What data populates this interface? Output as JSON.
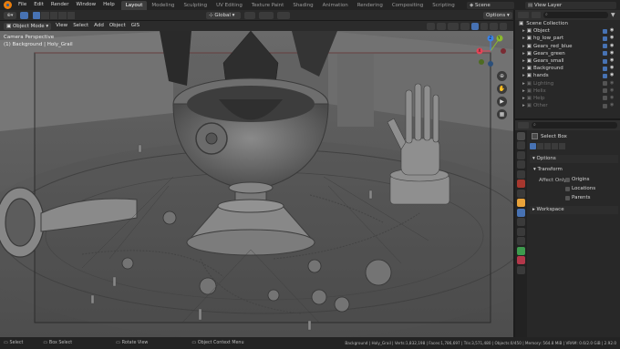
{
  "menu": {
    "items": [
      "File",
      "Edit",
      "Render",
      "Window",
      "Help"
    ]
  },
  "workspaces": [
    "Layout",
    "Modeling",
    "Sculpting",
    "UV Editing",
    "Texture Paint",
    "Shading",
    "Animation",
    "Rendering",
    "Compositing",
    "Scripting"
  ],
  "scene_label": "Scene",
  "view_layer_label": "View Layer",
  "header": {
    "transform_orientation": "Global",
    "options": "Options"
  },
  "header2": {
    "mode": "Object Mode",
    "view": "View",
    "select": "Select",
    "add": "Add",
    "object": "Object",
    "gis": "GIS"
  },
  "viewport": {
    "camera_label": "Camera Perspective",
    "object_label": "(1) Background | Holy_Grail",
    "nav_axes": [
      "Y",
      "Z",
      "X"
    ]
  },
  "outliner": {
    "title": "Scene Collection",
    "items": [
      {
        "name": "Object",
        "dim": false,
        "checked": true
      },
      {
        "name": "hg_low_part",
        "dim": false,
        "checked": true
      },
      {
        "name": "Gears_red_blue",
        "dim": false,
        "checked": true
      },
      {
        "name": "Gears_green",
        "dim": false,
        "checked": true
      },
      {
        "name": "Gears_small",
        "dim": false,
        "checked": true
      },
      {
        "name": "Background",
        "dim": false,
        "checked": true
      },
      {
        "name": "hands",
        "dim": false,
        "checked": true
      },
      {
        "name": "Lighting",
        "dim": true,
        "checked": false
      },
      {
        "name": "Helix",
        "dim": true,
        "checked": false
      },
      {
        "name": "Help",
        "dim": true,
        "checked": false
      },
      {
        "name": "Other",
        "dim": true,
        "checked": false
      }
    ]
  },
  "props": {
    "tool": "Select Box",
    "options": "Options",
    "transform": "Transform",
    "affect_only": "Affect Only",
    "origins": "Origins",
    "locations": "Locations",
    "parents": "Parents",
    "workspace": "Workspace"
  },
  "status": {
    "select": "Select",
    "box_select": "Box Select",
    "rotate_view": "Rotate View",
    "context_menu": "Object Context Menu",
    "stats": "Background | Holy_Grail | Verts:1,832,198 | Faces:1,786,697 | Tris:3,571,480 | Objects:0/450 | Memory: 564.8 MiB | VRAM: 0.6/2.0 GiB | 2.92.0"
  },
  "colors": {
    "accent": "#4772b3",
    "viewport": "#5b5b5b",
    "selection": "#e8a23a"
  }
}
